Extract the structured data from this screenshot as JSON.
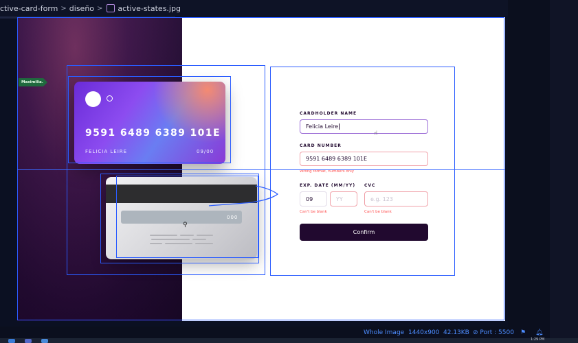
{
  "breadcrumb": {
    "segments": [
      "ctive-card-form",
      "diseño"
    ],
    "file_name": "active-states.jpg"
  },
  "card_front": {
    "number": "9591 6489 6389 101E",
    "holder": "FELICIA LEIRE",
    "expiry": "09/00"
  },
  "card_back": {
    "cvc": "000"
  },
  "form": {
    "cardholder_label": "CARDHOLDER NAME",
    "cardholder_value": "Felicia Leire",
    "card_number_label": "CARD NUMBER",
    "card_number_value": "9591 6489 6389 101E",
    "card_number_error": "Wrong format, numbers only",
    "exp_label": "EXP. DATE (MM/YY)",
    "exp_month_value": "09",
    "exp_year_placeholder": "YY",
    "exp_error": "Can't be blank",
    "cvc_label": "CVC",
    "cvc_placeholder": "e.g. 123",
    "cvc_error": "Can't be blank",
    "confirm_label": "Confirm"
  },
  "annotation_tag": "Maximilia...",
  "status_bar": {
    "mode": "Whole Image",
    "dimensions": "1440x900",
    "file_size": "42.13KB",
    "port": "Port : 5500"
  },
  "clock": "1:29 PM",
  "colors": {
    "accent": "#2a5cff",
    "dark_violet": "#21092f",
    "error_red": "#ff5252",
    "status_blue": "#4d8dff"
  }
}
